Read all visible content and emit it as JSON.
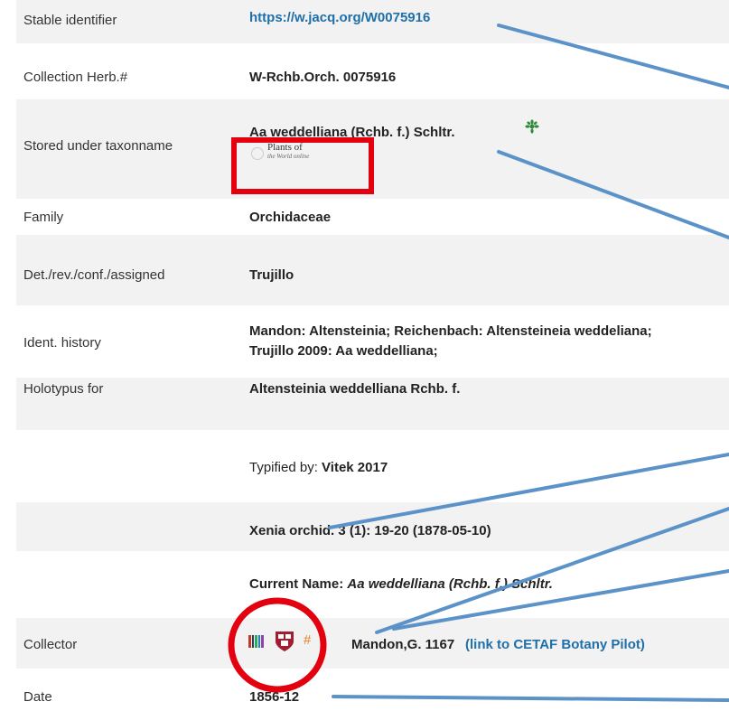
{
  "rows": {
    "stable": {
      "label": "Stable identifier",
      "value": "https://w.jacq.org/W0075916"
    },
    "collection": {
      "label": "Collection Herb.#",
      "value": "W-Rchb.Orch. 0075916"
    },
    "stored": {
      "label": "Stored under taxonname",
      "value": "Aa weddelliana (Rchb. f.) Schltr.",
      "pow_logo_line1": "Plants of",
      "pow_logo_line2": "the World online"
    },
    "family": {
      "label": "Family",
      "value": "Orchidaceae"
    },
    "det": {
      "label": "Det./rev./conf./assigned",
      "value": "Trujillo"
    },
    "ident": {
      "label": "Ident. history",
      "line1": "Mandon: Altensteinia; Reichenbach: Altensteineia weddeliana;",
      "line2": "Trujillo 2009: Aa weddelliana;"
    },
    "holotypus": {
      "label": "Holotypus for",
      "value": "Altensteinia weddelliana Rchb. f."
    },
    "typified": {
      "prefix": "Typified by: ",
      "value": "Vitek 2017"
    },
    "xenia": {
      "value": "Xenia orchid. 3 (1): 19-20 (1878-05-10)"
    },
    "current": {
      "prefix": "Current Name: ",
      "value": "Aa weddelliana (Rchb. f.) Schltr."
    },
    "collector": {
      "label": "Collector",
      "value": "Mandon,G. 1167",
      "link": "(link to CETAF Botany Pilot)"
    },
    "date": {
      "label": "Date",
      "value": "1856-12"
    }
  },
  "colors": {
    "link": "#1f6fa8",
    "annotation_line": "#5b93c9",
    "highlight": "#e3000f",
    "row_alt": "#f2f2f2"
  },
  "icons": [
    "leaf-icon",
    "bionomia-icon",
    "harvard-shield-icon",
    "hashtag-icon"
  ]
}
